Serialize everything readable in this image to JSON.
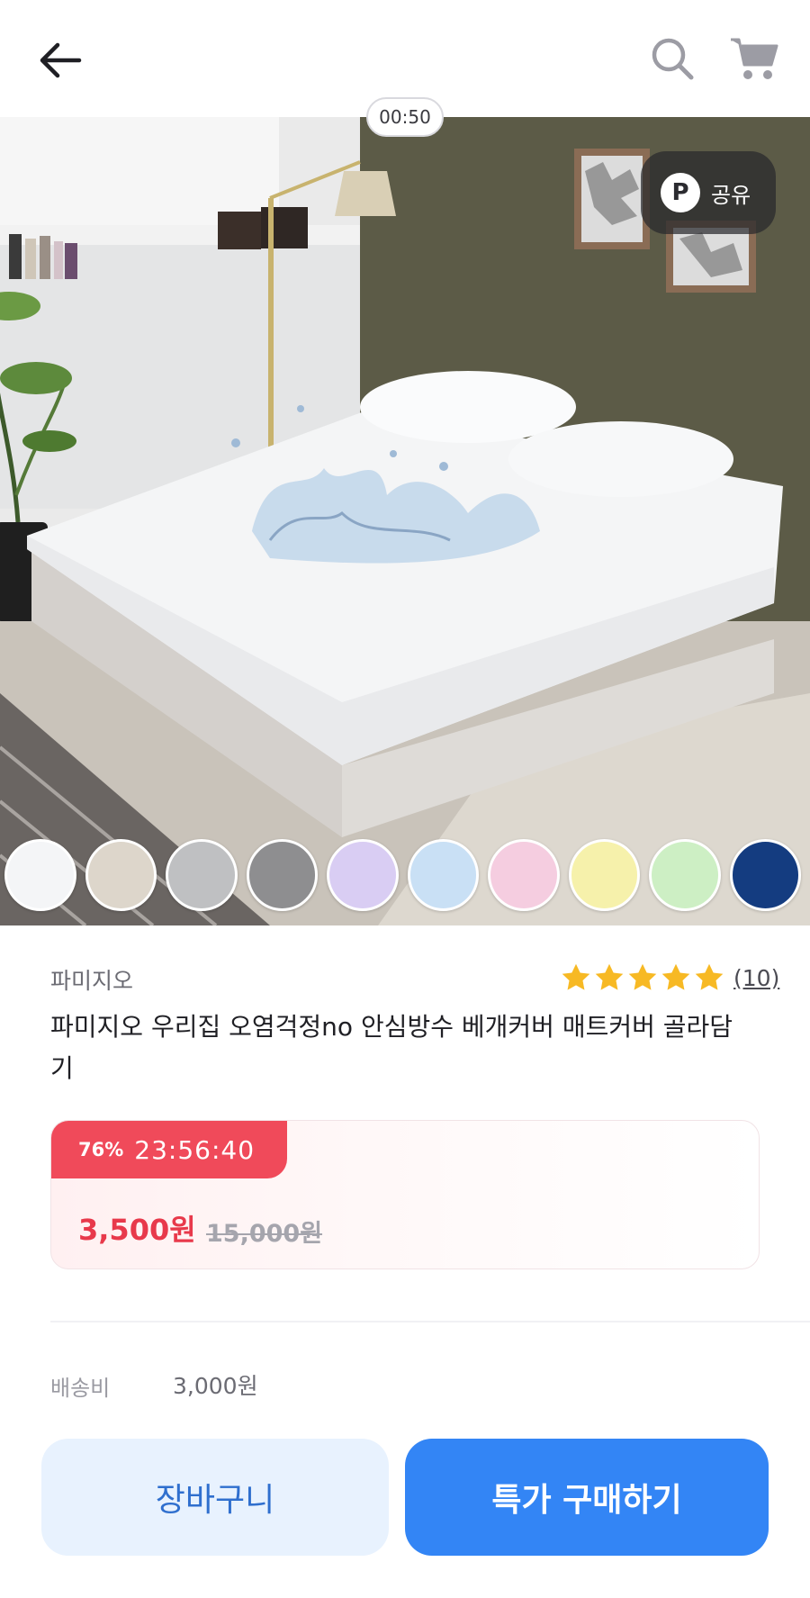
{
  "header": {
    "back_icon": "back-arrow-icon",
    "search_icon": "search-icon",
    "cart_icon": "cart-icon"
  },
  "media": {
    "video_timer": "00:50",
    "share": {
      "badge_letter": "P",
      "label": "공유"
    },
    "color_swatches": [
      {
        "name": "white",
        "color": "#f4f5f7"
      },
      {
        "name": "beige",
        "color": "#ddd6cb"
      },
      {
        "name": "light-gray",
        "color": "#bfc0c2"
      },
      {
        "name": "gray",
        "color": "#8e8e90"
      },
      {
        "name": "lavender",
        "color": "#d9cdf3"
      },
      {
        "name": "sky-blue",
        "color": "#c9e0f5"
      },
      {
        "name": "pink",
        "color": "#f5cde0"
      },
      {
        "name": "yellow",
        "color": "#f6f1ab"
      },
      {
        "name": "mint",
        "color": "#cdefc4"
      },
      {
        "name": "navy",
        "color": "#143c80"
      }
    ]
  },
  "product": {
    "brand": "파미지오",
    "rating_stars": 5,
    "review_count": "(10)",
    "title": "파미지오 우리집 오염걱정no 안심방수 베개커버 매트커버 골라담기"
  },
  "deal": {
    "discount_rate": "76%",
    "countdown": "23:56:40",
    "sale_price": "3,500원",
    "original_price": "15,000원"
  },
  "shipping": {
    "label": "배송비",
    "value": "3,000원"
  },
  "actions": {
    "cart_label": "장바구니",
    "buy_label": "특가 구매하기"
  },
  "colors": {
    "accent_red": "#f04a5a",
    "price_red": "#e8394b",
    "primary_blue": "#3385f5",
    "light_blue": "#e8f2fe",
    "star_yellow": "#f7b924"
  }
}
